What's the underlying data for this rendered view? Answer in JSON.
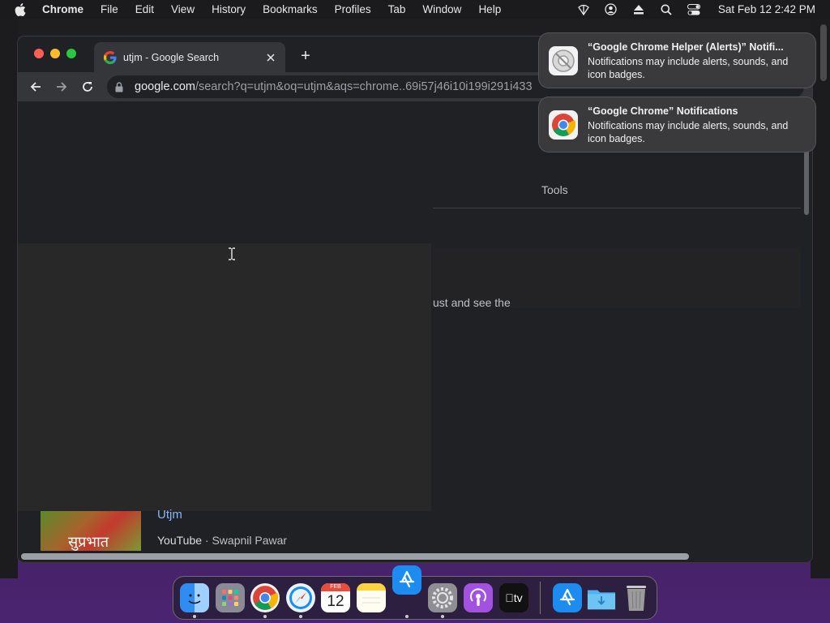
{
  "menubar": {
    "app_name": "Chrome",
    "items": [
      "File",
      "Edit",
      "View",
      "History",
      "Bookmarks",
      "Profiles",
      "Tab",
      "Window",
      "Help"
    ],
    "clock": "Sat Feb 12  2:42 PM",
    "status_icons": [
      "wifi-off-icon",
      "user-account-icon",
      "eject-icon",
      "spotlight-search-icon",
      "control-center-icon"
    ]
  },
  "browser": {
    "tab_title": "utjm - Google Search",
    "new_tab_label": "+",
    "url_host": "google.com",
    "url_path": "/search?q=utjm&oq=utjm&aqs=chrome..69i57j46i10i199i291i433"
  },
  "page": {
    "tools_label": "Tools",
    "snippet_text": "ust and see the",
    "result": {
      "title": "Utjm",
      "source_site": "YouTube",
      "source_sep": " · ",
      "source_author": "Swapnil Pawar",
      "thumbnail_text": "सुप्रभात"
    }
  },
  "notifications": [
    {
      "title": "“Google Chrome Helper (Alerts)” Notifi...",
      "body": "Notifications may include alerts, sounds, and icon badges.",
      "icon": "chrome-helper-icon"
    },
    {
      "title": "“Google Chrome” Notifications",
      "body": "Notifications may include alerts, sounds, and icon badges.",
      "icon": "chrome-icon"
    }
  ],
  "dock": {
    "apps": [
      "Finder",
      "Launchpad",
      "Google Chrome",
      "Safari",
      "Calendar",
      "Notes",
      "App Store",
      "System Preferences",
      "Podcasts",
      "TV",
      "App Store",
      "Downloads",
      "Trash"
    ],
    "calendar_month": "FEB",
    "calendar_day": "12",
    "tv_label": "tv"
  },
  "colors": {
    "link_blue": "#8ab4f8",
    "window_bg": "#202124",
    "toolbar_bg": "#35363a"
  }
}
